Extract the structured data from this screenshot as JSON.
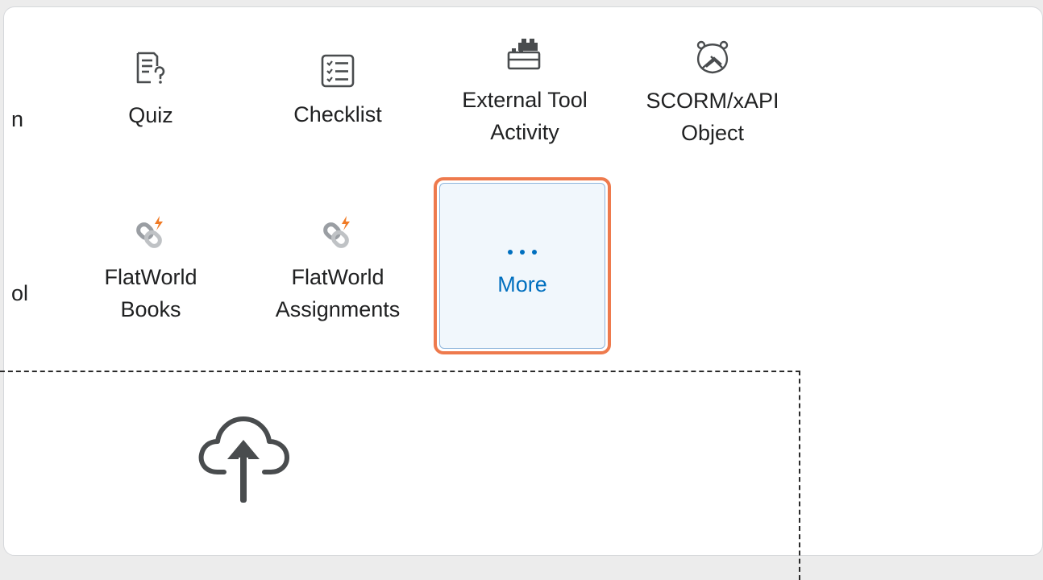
{
  "tiles_row1": [
    {
      "name": "quiz",
      "label": "Quiz",
      "icon": "quiz-icon"
    },
    {
      "name": "checklist",
      "label": "Checklist",
      "icon": "checklist-icon"
    },
    {
      "name": "external-tool-activity",
      "label": "External Tool\nActivity",
      "icon": "lego-brick-icon"
    },
    {
      "name": "scorm-xapi-object",
      "label": "SCORM/xAPI\nObject",
      "icon": "scorm-package-icon"
    }
  ],
  "partial_row1": "n",
  "tiles_row2": [
    {
      "name": "flatworld-books",
      "label": "FlatWorld\nBooks",
      "icon": "flatworld-link-icon"
    },
    {
      "name": "flatworld-assignments",
      "label": "FlatWorld\nAssignments",
      "icon": "flatworld-link-icon"
    }
  ],
  "partial_row2": "ol",
  "more": {
    "label": "More",
    "icon": "ellipsis-icon"
  },
  "upload": {
    "icon": "cloud-upload-icon"
  },
  "colors": {
    "accent": "#006fbf",
    "highlight": "#ee7a4d",
    "flatworld_orange": "#f07a24",
    "text": "#202122",
    "icon": "#494c4e"
  }
}
